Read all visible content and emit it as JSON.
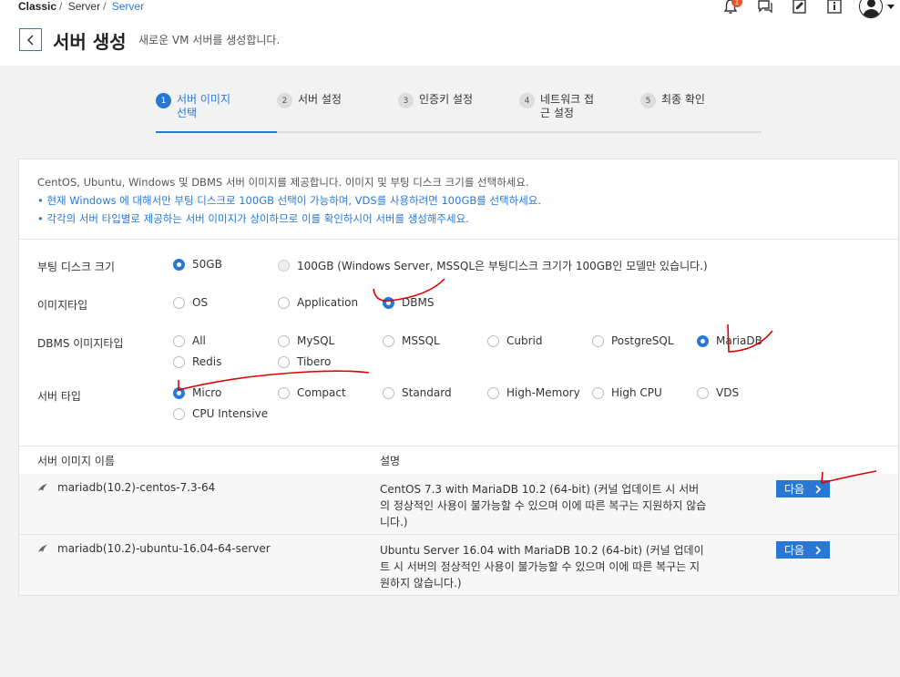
{
  "breadcrumb": [
    "Classic",
    "Server",
    "Server"
  ],
  "header": {
    "title": "서버 생성",
    "subtitle": "새로운 VM 서버를 생성합니다.",
    "notification_count": "1"
  },
  "steps": [
    {
      "num": "1",
      "label": "서버 이미지 선택",
      "active": true
    },
    {
      "num": "2",
      "label": "서버 설정",
      "active": false
    },
    {
      "num": "3",
      "label": "인증키 설정",
      "active": false
    },
    {
      "num": "4",
      "label": "네트워크 접근 설정",
      "active": false
    },
    {
      "num": "5",
      "label": "최종 확인",
      "active": false
    }
  ],
  "intro": {
    "line1": "CentOS, Ubuntu, Windows 및 DBMS 서버 이미지를 제공합니다. 이미지 및 부팅 디스크 크기를 선택하세요.",
    "bullet1": "• 현재 Windows 에 대해서만 부팅 디스크로 100GB 선택이 가능하며, VDS를 사용하려면 100GB를 선택하세요.",
    "bullet2": "• 각각의 서버 타입별로 제공하는 서버 이미지가 상이하므로 이를 확인하시어 서버를 생성해주세요."
  },
  "options": {
    "boot_disk": {
      "label": "부팅 디스크 크기",
      "items": [
        "50GB",
        "100GB (Windows Server, MSSQL은 부팅디스크 크기가 100GB인 모델만 있습니다.)"
      ],
      "selected": "50GB"
    },
    "image_type": {
      "label": "이미지타입",
      "items": [
        "OS",
        "Application",
        "DBMS"
      ],
      "selected": "DBMS"
    },
    "dbms_type": {
      "label": "DBMS 이미지타입",
      "items": [
        "All",
        "MySQL",
        "MSSQL",
        "Cubrid",
        "PostgreSQL",
        "MariaDB",
        "Redis",
        "Tibero"
      ],
      "selected": "MariaDB"
    },
    "server_type": {
      "label": "서버 타입",
      "items": [
        "Micro",
        "Compact",
        "Standard",
        "High-Memory",
        "High CPU",
        "VDS",
        "CPU Intensive"
      ],
      "selected": "Micro"
    }
  },
  "table": {
    "headers": [
      "서버 이미지 이름",
      "설명"
    ],
    "rows": [
      {
        "name": "mariadb(10.2)-centos-7.3-64",
        "desc": "CentOS 7.3 with MariaDB 10.2 (64-bit) (커널 업데이트 시 서버의 정상적인 사용이 불가능할 수 있으며 이에 따른 복구는 지원하지 않습니다.)",
        "button": "다음"
      },
      {
        "name": "mariadb(10.2)-ubuntu-16.04-64-server",
        "desc": "Ubuntu Server 16.04 with MariaDB 10.2 (64-bit) (커널 업데이트 시 서버의 정상적인 사용이 불가능할 수 있으며 이에 따른 복구는 지원하지 않습니다.)",
        "button": "다음"
      }
    ]
  },
  "colors": {
    "accent": "#2a78d6",
    "annotation": "#e00000"
  }
}
